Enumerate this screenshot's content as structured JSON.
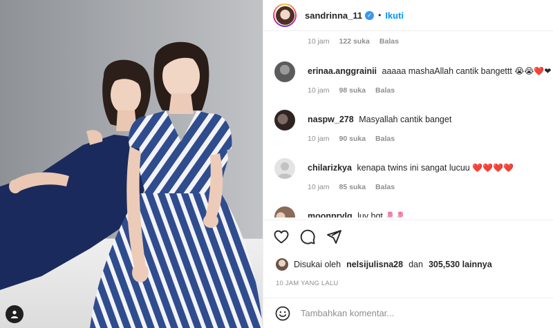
{
  "post": {
    "username": "sandrinna_11",
    "follow_label": "Ikuti",
    "dot": "•",
    "verified_mark": "✓"
  },
  "first_comment_meta": {
    "time": "10 jam",
    "likes": "122 suka",
    "reply": "Balas"
  },
  "comments": [
    {
      "username": "erinaa.anggrainii",
      "text": "aaaaa mashaAllah cantik bangettt",
      "emoji": "😭😭❤️❤",
      "time": "10 jam",
      "likes": "98 suka",
      "reply": "Balas",
      "avatar_color": "#5b5b5b"
    },
    {
      "username": "naspw_278",
      "text": "Masyallah cantik banget",
      "emoji": "",
      "time": "10 jam",
      "likes": "90 suka",
      "reply": "Balas",
      "avatar_color": "#3a2c2a"
    },
    {
      "username": "chilarizkya",
      "text": "kenapa twins ini sangat lucuu",
      "emoji": "❤️❤️❤️❤️",
      "time": "10 jam",
      "likes": "85 suka",
      "reply": "Balas",
      "avatar_color": "#dbdbdb"
    },
    {
      "username": "moonprvlg",
      "text": "luv bqt",
      "emoji": "🌷🌷",
      "time": "",
      "likes": "",
      "reply": "",
      "avatar_color": "#c9a58e"
    }
  ],
  "actions": {
    "icons": [
      "heart-icon",
      "comment-icon",
      "share-icon"
    ]
  },
  "likes": {
    "prefix": "Disukai oleh",
    "user": "nelsijulisna28",
    "joiner": "dan",
    "others": "305,530 lainnya"
  },
  "time_ago": "10 JAM YANG LALU",
  "comment_input": {
    "placeholder": "Tambahkan komentar..."
  },
  "colors": {
    "accent": "#0095f6",
    "verified": "#3897f0",
    "dress_left": "#1b2a5c",
    "dress_right_stripe": "#2e4a8a"
  }
}
